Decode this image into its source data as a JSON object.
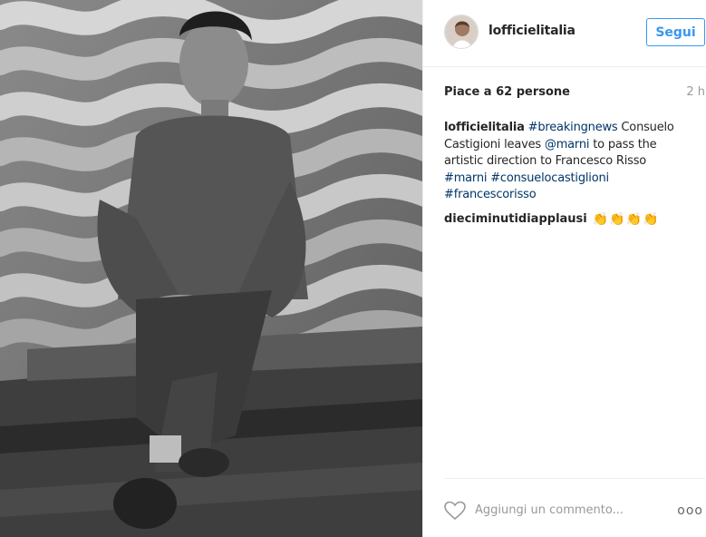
{
  "post": {
    "username": "lofficielitalia",
    "follow_label": "Segui",
    "likes": "Piace a 62 persone",
    "time": "2 h"
  },
  "caption": {
    "username": "lofficielitalia",
    "tag_breaking": "#breakingnews",
    "text_1": " Consuelo Castigioni leaves ",
    "mention_marni": "@marni",
    "text_2": " to pass the artistic direction to Francesco Risso",
    "tag_marni": "#marni",
    "tag_consuelo": "#consuelocastiglioni",
    "tag_francesco": "#francescorisso"
  },
  "comment": {
    "username": "dieciminutidiapplausi",
    "emoji": "👏"
  },
  "footer": {
    "placeholder": "Aggiungi un commento...",
    "more": "ooo"
  },
  "icons": {
    "heart": "heart-icon",
    "more": "more-options-icon"
  },
  "colors": {
    "accent": "#3897f0",
    "link": "#003569",
    "muted": "#999999"
  }
}
